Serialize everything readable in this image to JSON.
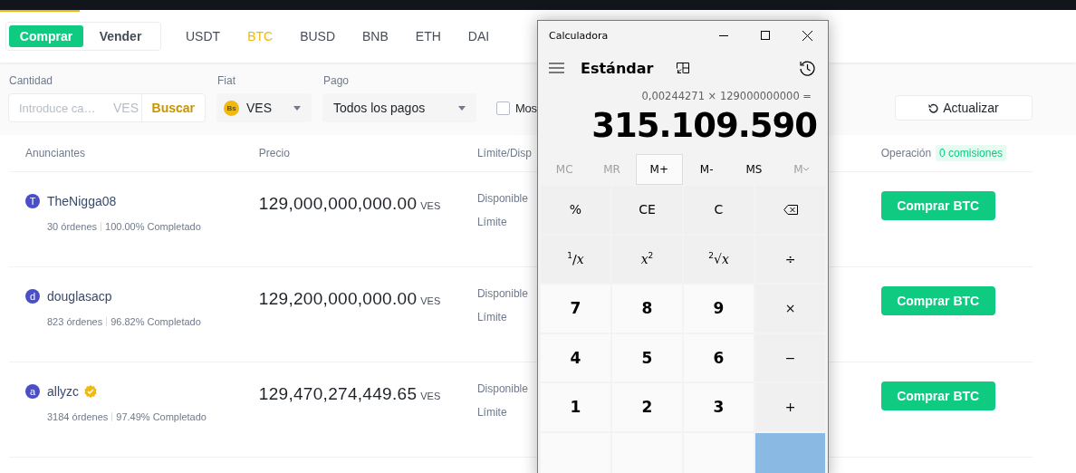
{
  "trade_toggle": [
    {
      "label": "Comprar",
      "selected": true
    },
    {
      "label": "Vender",
      "selected": false
    }
  ],
  "assets": [
    {
      "label": "USDT",
      "selected": false
    },
    {
      "label": "BTC",
      "selected": true
    },
    {
      "label": "BUSD",
      "selected": false
    },
    {
      "label": "BNB",
      "selected": false
    },
    {
      "label": "ETH",
      "selected": false
    },
    {
      "label": "DAI",
      "selected": false
    }
  ],
  "filters": {
    "amount": {
      "label": "Cantidad",
      "placeholder": "Introduce ca…",
      "currency": "VES",
      "button": "Buscar"
    },
    "fiat": {
      "label": "Fiat",
      "badge": "Bs",
      "value": "VES"
    },
    "payment": {
      "label": "Pago",
      "value": "Todos los pagos"
    },
    "checkbox": {
      "label": "Mos",
      "checked": false
    },
    "refresh": "Actualizar"
  },
  "table": {
    "columns": [
      "Anunciantes",
      "Precio",
      "Límite/Disp",
      "Operación"
    ],
    "fee_badge": "0 comisiones",
    "rows": [
      {
        "avatar": "T",
        "name": "TheNigga08",
        "verified": false,
        "orders": "30 órdenes",
        "completion": "100.00% Completado",
        "price": "129,000,000,000.00",
        "currency": "VES",
        "available_label": "Disponible",
        "limit_label": "Límite",
        "action": "Comprar BTC"
      },
      {
        "avatar": "d",
        "name": "douglasacp",
        "verified": false,
        "orders": "823 órdenes",
        "completion": "96.82% Completado",
        "price": "129,200,000,000.00",
        "currency": "VES",
        "available_label": "Disponible",
        "limit_label": "Límite",
        "action": "Comprar BTC"
      },
      {
        "avatar": "a",
        "name": "allyzc",
        "verified": true,
        "orders": "3184 órdenes",
        "completion": "97.49% Completado",
        "price": "129,470,274,449.65",
        "currency": "VES",
        "available_label": "Disponible",
        "limit_label": "Límite",
        "action": "Comprar BTC"
      }
    ]
  },
  "calculator": {
    "title": "Calculadora",
    "mode": "Estándar",
    "expression": "0,00244271 × 129000000000 =",
    "result": "315.109.590",
    "memory": [
      {
        "label": "MC",
        "disabled": true,
        "hovered": false
      },
      {
        "label": "MR",
        "disabled": true,
        "hovered": false
      },
      {
        "label": "M+",
        "disabled": false,
        "hovered": true
      },
      {
        "label": "M-",
        "disabled": false,
        "hovered": false
      },
      {
        "label": "MS",
        "disabled": false,
        "hovered": false
      },
      {
        "label": "M",
        "disabled": true,
        "hovered": false,
        "chevron": true
      }
    ],
    "keys": [
      {
        "kind": "function",
        "label": "%"
      },
      {
        "kind": "function",
        "label": "CE"
      },
      {
        "kind": "function",
        "label": "C"
      },
      {
        "kind": "backspace"
      },
      {
        "kind": "function",
        "label": "$^{1}$/*x*"
      },
      {
        "kind": "function",
        "label": "*x*$^{2}$"
      },
      {
        "kind": "function",
        "label": "$^{2}$√*x*"
      },
      {
        "kind": "function",
        "label": "÷"
      },
      {
        "kind": "digit",
        "label": "7"
      },
      {
        "kind": "digit",
        "label": "8"
      },
      {
        "kind": "digit",
        "label": "9"
      },
      {
        "kind": "function",
        "label": "×"
      },
      {
        "kind": "digit",
        "label": "4"
      },
      {
        "kind": "digit",
        "label": "5"
      },
      {
        "kind": "digit",
        "label": "6"
      },
      {
        "kind": "function",
        "label": "−"
      },
      {
        "kind": "digit",
        "label": "1"
      },
      {
        "kind": "digit",
        "label": "2"
      },
      {
        "kind": "digit",
        "label": "3"
      },
      {
        "kind": "function",
        "label": "+"
      },
      {
        "kind": "digit"
      },
      {
        "kind": "digit"
      },
      {
        "kind": "digit"
      },
      {
        "kind": "equals"
      }
    ]
  }
}
